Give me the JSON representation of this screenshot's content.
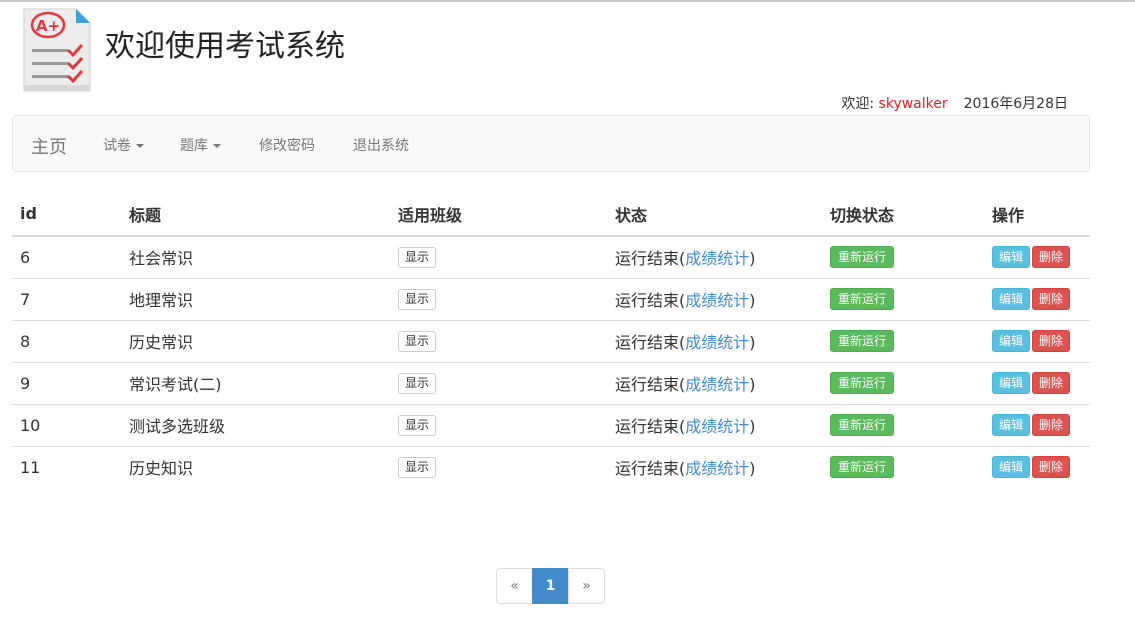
{
  "header": {
    "title": "欢迎使用考试系统",
    "welcome_label": "欢迎: ",
    "username": "skywalker",
    "date": "2016年6月28日",
    "logo_text": "A+"
  },
  "navbar": {
    "brand": "主页",
    "items": [
      {
        "label": "试卷",
        "dropdown": true
      },
      {
        "label": "题库",
        "dropdown": true
      },
      {
        "label": "修改密码",
        "dropdown": false
      },
      {
        "label": "退出系统",
        "dropdown": false
      }
    ]
  },
  "table": {
    "columns": [
      "id",
      "标题",
      "适用班级",
      "状态",
      "切换状态",
      "操作"
    ],
    "rows": [
      {
        "id": "6",
        "title": "社会常识",
        "show": "显示",
        "status": "运行结束(",
        "stat_link": "成绩统计",
        "status_end": ")",
        "toggle": "重新运行",
        "edit": "编辑",
        "delete": "删除"
      },
      {
        "id": "7",
        "title": "地理常识",
        "show": "显示",
        "status": "运行结束(",
        "stat_link": "成绩统计",
        "status_end": ")",
        "toggle": "重新运行",
        "edit": "编辑",
        "delete": "删除"
      },
      {
        "id": "8",
        "title": "历史常识",
        "show": "显示",
        "status": "运行结束(",
        "stat_link": "成绩统计",
        "status_end": ")",
        "toggle": "重新运行",
        "edit": "编辑",
        "delete": "删除"
      },
      {
        "id": "9",
        "title": "常识考试(二)",
        "show": "显示",
        "status": "运行结束(",
        "stat_link": "成绩统计",
        "status_end": ")",
        "toggle": "重新运行",
        "edit": "编辑",
        "delete": "删除"
      },
      {
        "id": "10",
        "title": "测试多选班级",
        "show": "显示",
        "status": "运行结束(",
        "stat_link": "成绩统计",
        "status_end": ")",
        "toggle": "重新运行",
        "edit": "编辑",
        "delete": "删除"
      },
      {
        "id": "11",
        "title": "历史知识",
        "show": "显示",
        "status": "运行结束(",
        "stat_link": "成绩统计",
        "status_end": ")",
        "toggle": "重新运行",
        "edit": "编辑",
        "delete": "删除"
      }
    ]
  },
  "pagination": {
    "prev": "«",
    "current": "1",
    "next": "»"
  },
  "colors": {
    "accent": "#428bca",
    "success": "#5cb85c",
    "info": "#5bc0de",
    "danger": "#d9534f",
    "username": "#d9232b"
  }
}
